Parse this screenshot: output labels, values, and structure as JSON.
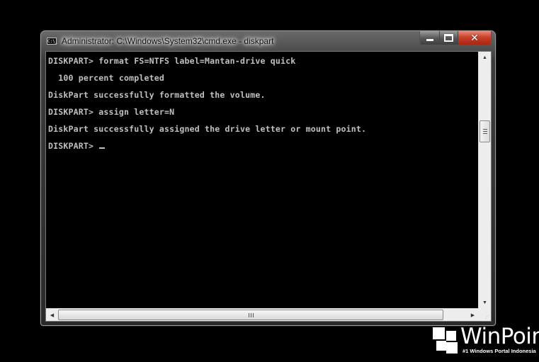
{
  "window": {
    "title": "Administrator: C:\\Windows\\System32\\cmd.exe - diskpart",
    "icon": "cmd-icon",
    "icon_text": "C:\\_",
    "buttons": {
      "minimize": "minimize-icon",
      "maximize": "maximize-icon",
      "close": "close-icon",
      "close_glyph": "✕"
    }
  },
  "console": {
    "lines": [
      "DISKPART> format FS=NTFS label=Mantan-drive quick",
      "  100 percent completed",
      "DiskPart successfully formatted the volume.",
      "DISKPART> assign letter=N",
      "DiskPart successfully assigned the drive letter or mount point.",
      "DISKPART> "
    ],
    "background": "#000000",
    "foreground": "#c0c0c0"
  },
  "scrollbars": {
    "vertical": {
      "up_arrow": "▲",
      "down_arrow": "▼",
      "position_fraction": 0.27
    },
    "horizontal": {
      "left_arrow": "◀",
      "right_arrow": "▶",
      "grip": "⋰"
    }
  },
  "watermark": {
    "brand": "WinPoin",
    "tagline": "#1 Windows Portal Indonesia"
  }
}
